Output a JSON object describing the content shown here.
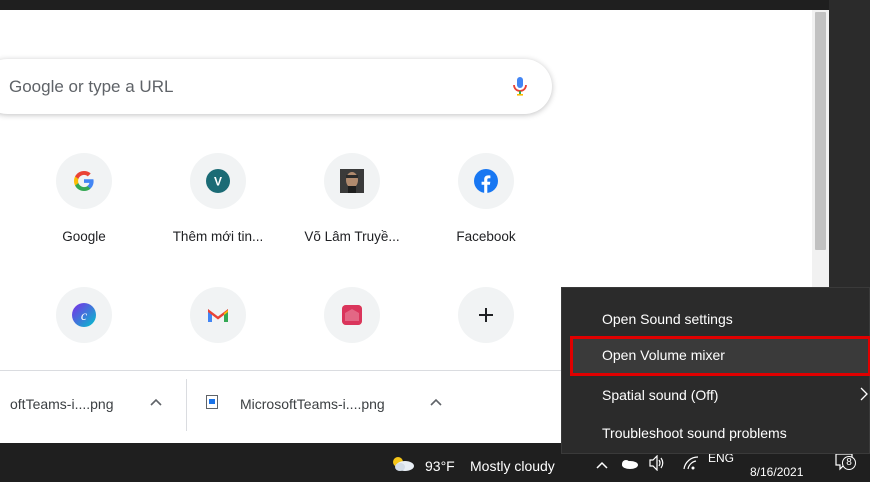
{
  "browser": {
    "omnibox": {
      "placeholder": "Google or type a URL"
    },
    "shortcuts": [
      {
        "label": "Google",
        "icon": "google-icon"
      },
      {
        "label": "Thêm mới tin...",
        "icon": "avatar-v-icon"
      },
      {
        "label": "Võ Lâm Truyề...",
        "icon": "game-avatar-icon"
      },
      {
        "label": "Facebook",
        "icon": "facebook-icon"
      },
      {
        "label": "",
        "icon": "canva-icon"
      },
      {
        "label": "",
        "icon": "gmail-icon"
      },
      {
        "label": "",
        "icon": "lazada-icon"
      },
      {
        "label": "",
        "icon": "add-shortcut-icon"
      }
    ],
    "downloads": [
      {
        "name": "oftTeams-i....png"
      },
      {
        "name": "MicrosoftTeams-i....png"
      }
    ]
  },
  "context_menu": {
    "items": [
      {
        "label": "Open Sound settings"
      },
      {
        "label": "Open Volume mixer",
        "highlighted": true
      },
      {
        "label": "Spatial sound (Off)",
        "has_submenu": true
      },
      {
        "label": "Troubleshoot sound problems"
      }
    ]
  },
  "taskbar": {
    "weather": {
      "temp": "93°F",
      "condition": "Mostly cloudy",
      "icon": "cloud-sun-icon"
    },
    "language": "ENG",
    "date": "8/16/2021",
    "notification_count": "8"
  },
  "colors": {
    "highlight_border": "#e00000",
    "menu_bg": "#2b2b2b",
    "taskbar_bg": "#1f1f1f"
  }
}
